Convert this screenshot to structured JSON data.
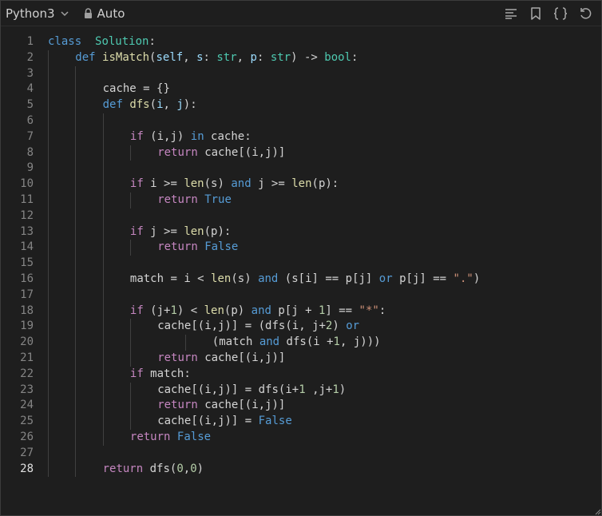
{
  "toolbar": {
    "language": "Python3",
    "mode": "Auto",
    "icons": [
      "format-icon",
      "bookmark-icon",
      "braces-icon",
      "reset-icon"
    ]
  },
  "editor": {
    "active_line": 28,
    "lines": [
      {
        "n": "1",
        "indent": 0,
        "tokens": [
          [
            "kw",
            "class"
          ],
          [
            "",
            "  "
          ],
          [
            "cls",
            "Solution"
          ],
          [
            "",
            ":"
          ]
        ]
      },
      {
        "n": "2",
        "indent": 1,
        "tokens": [
          [
            "kw",
            "def"
          ],
          [
            "",
            " "
          ],
          [
            "fn",
            "isMatch"
          ],
          [
            "",
            "("
          ],
          [
            "prm",
            "self"
          ],
          [
            "",
            ", "
          ],
          [
            "prm",
            "s"
          ],
          [
            "",
            ": "
          ],
          [
            "bi",
            "str"
          ],
          [
            "",
            ", "
          ],
          [
            "prm",
            "p"
          ],
          [
            "",
            ": "
          ],
          [
            "bi",
            "str"
          ],
          [
            "",
            ") -> "
          ],
          [
            "bi",
            "bool"
          ],
          [
            "",
            ":"
          ]
        ]
      },
      {
        "n": "3",
        "indent": 2,
        "tokens": []
      },
      {
        "n": "4",
        "indent": 2,
        "tokens": [
          [
            "",
            "cache = {}"
          ]
        ]
      },
      {
        "n": "5",
        "indent": 2,
        "tokens": [
          [
            "kw",
            "def"
          ],
          [
            "",
            " "
          ],
          [
            "fn",
            "dfs"
          ],
          [
            "",
            "("
          ],
          [
            "prm",
            "i"
          ],
          [
            "",
            ", "
          ],
          [
            "prm",
            "j"
          ],
          [
            "",
            "):"
          ]
        ]
      },
      {
        "n": "6",
        "indent": 3,
        "tokens": []
      },
      {
        "n": "7",
        "indent": 3,
        "tokens": [
          [
            "ctl",
            "if"
          ],
          [
            "",
            " (i,j) "
          ],
          [
            "kw",
            "in"
          ],
          [
            "",
            " cache:"
          ]
        ]
      },
      {
        "n": "8",
        "indent": 4,
        "tokens": [
          [
            "ctl",
            "return"
          ],
          [
            "",
            " cache[(i,j)]"
          ]
        ]
      },
      {
        "n": "9",
        "indent": 3,
        "tokens": []
      },
      {
        "n": "10",
        "indent": 3,
        "tokens": [
          [
            "ctl",
            "if"
          ],
          [
            "",
            " i >= "
          ],
          [
            "fn",
            "len"
          ],
          [
            "",
            "(s) "
          ],
          [
            "kw",
            "and"
          ],
          [
            "",
            " j >= "
          ],
          [
            "fn",
            "len"
          ],
          [
            "",
            "(p):"
          ]
        ]
      },
      {
        "n": "11",
        "indent": 4,
        "tokens": [
          [
            "ctl",
            "return"
          ],
          [
            "",
            " "
          ],
          [
            "kw",
            "True"
          ]
        ]
      },
      {
        "n": "12",
        "indent": 3,
        "tokens": []
      },
      {
        "n": "13",
        "indent": 3,
        "tokens": [
          [
            "ctl",
            "if"
          ],
          [
            "",
            " j >= "
          ],
          [
            "fn",
            "len"
          ],
          [
            "",
            "(p):"
          ]
        ]
      },
      {
        "n": "14",
        "indent": 4,
        "tokens": [
          [
            "ctl",
            "return"
          ],
          [
            "",
            " "
          ],
          [
            "kw",
            "False"
          ]
        ]
      },
      {
        "n": "15",
        "indent": 3,
        "tokens": []
      },
      {
        "n": "16",
        "indent": 3,
        "tokens": [
          [
            "",
            "match = i < "
          ],
          [
            "fn",
            "len"
          ],
          [
            "",
            "(s) "
          ],
          [
            "kw",
            "and"
          ],
          [
            "",
            " (s[i] == p[j] "
          ],
          [
            "kw",
            "or"
          ],
          [
            "",
            " p[j] == "
          ],
          [
            "str",
            "\".\""
          ],
          [
            "",
            ")"
          ]
        ]
      },
      {
        "n": "17",
        "indent": 3,
        "tokens": []
      },
      {
        "n": "18",
        "indent": 3,
        "tokens": [
          [
            "ctl",
            "if"
          ],
          [
            "",
            " (j+"
          ],
          [
            "num",
            "1"
          ],
          [
            "",
            ") < "
          ],
          [
            "fn",
            "len"
          ],
          [
            "",
            "(p) "
          ],
          [
            "kw",
            "and"
          ],
          [
            "",
            " p[j + "
          ],
          [
            "num",
            "1"
          ],
          [
            "",
            "] == "
          ],
          [
            "str",
            "\"*\""
          ],
          [
            "",
            ":"
          ]
        ]
      },
      {
        "n": "19",
        "indent": 4,
        "tokens": [
          [
            "",
            "cache[(i,j)] = (dfs(i, j+"
          ],
          [
            "num",
            "2"
          ],
          [
            "",
            ") "
          ],
          [
            "kw",
            "or"
          ]
        ]
      },
      {
        "n": "20",
        "indent": 6,
        "tokens": [
          [
            "",
            "(match "
          ],
          [
            "kw",
            "and"
          ],
          [
            "",
            " dfs(i +"
          ],
          [
            "num",
            "1"
          ],
          [
            "",
            ", j)))"
          ]
        ]
      },
      {
        "n": "21",
        "indent": 4,
        "tokens": [
          [
            "ctl",
            "return"
          ],
          [
            "",
            " cache[(i,j)]"
          ]
        ]
      },
      {
        "n": "22",
        "indent": 3,
        "tokens": [
          [
            "ctl",
            "if"
          ],
          [
            "",
            " match:"
          ]
        ]
      },
      {
        "n": "23",
        "indent": 4,
        "tokens": [
          [
            "",
            "cache[(i,j)] = dfs(i+"
          ],
          [
            "num",
            "1"
          ],
          [
            "",
            " ,j+"
          ],
          [
            "num",
            "1"
          ],
          [
            "",
            ")"
          ]
        ]
      },
      {
        "n": "24",
        "indent": 4,
        "tokens": [
          [
            "ctl",
            "return"
          ],
          [
            "",
            " cache[(i,j)]"
          ]
        ]
      },
      {
        "n": "25",
        "indent": 4,
        "tokens": [
          [
            "",
            "cache[(i,j)] = "
          ],
          [
            "kw",
            "False"
          ]
        ]
      },
      {
        "n": "26",
        "indent": 3,
        "tokens": [
          [
            "ctl",
            "return"
          ],
          [
            "",
            " "
          ],
          [
            "kw",
            "False"
          ]
        ]
      },
      {
        "n": "27",
        "indent": 2,
        "tokens": []
      },
      {
        "n": "28",
        "indent": 2,
        "tokens": [
          [
            "ctl",
            "return"
          ],
          [
            "",
            " dfs("
          ],
          [
            "num",
            "0"
          ],
          [
            "",
            ","
          ],
          [
            "num",
            "0"
          ],
          [
            "",
            ")"
          ]
        ]
      }
    ]
  }
}
